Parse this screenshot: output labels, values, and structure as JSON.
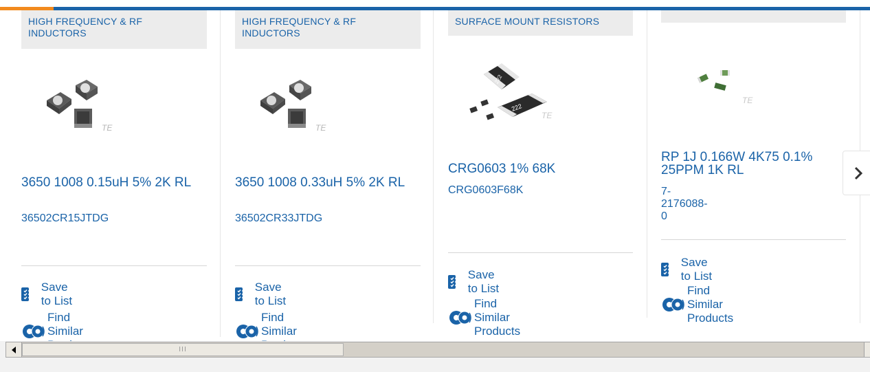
{
  "colors": {
    "brand_blue": "#1a63a8",
    "accent_orange": "#f28a1e",
    "category_bg": "#ececec"
  },
  "cards": [
    {
      "category": "HIGH FREQUENCY & RF INDUCTORS",
      "image": "inductor-product-photo",
      "title": "3650 1008 0.15uH 5% 2K RL",
      "part_number": "36502CR15JTDG",
      "save_label": "Save to List",
      "similar_label": "Find Similar Products"
    },
    {
      "category": "HIGH FREQUENCY & RF INDUCTORS",
      "image": "inductor-product-photo",
      "title": "3650 1008 0.33uH 5% 2K RL",
      "part_number": "36502CR33JTDG",
      "save_label": "Save to List",
      "similar_label": "Find Similar Products"
    },
    {
      "category": "SURFACE MOUNT RESISTORS",
      "image": "resistor-product-photo",
      "title": "CRG0603 1% 68K",
      "part_number": "CRG0603F68K",
      "save_label": "Save to List",
      "similar_label": "Find Similar Products"
    },
    {
      "category": "",
      "image": "thin-film-resistor-product-photo",
      "title": "RP 1J 0.166W 4K75 0.1% 25PPM 1K RL",
      "part_number": "7-2176088-0",
      "save_label": "Save to List",
      "similar_label": "Find Similar Products"
    }
  ],
  "logo_text": "TE",
  "resistor_marking": "222",
  "carousel": {
    "next_icon": "chevron-right-icon"
  },
  "scrollbar": {
    "left_icon": "scroll-left-arrow-icon",
    "thumb_grip": "III"
  }
}
